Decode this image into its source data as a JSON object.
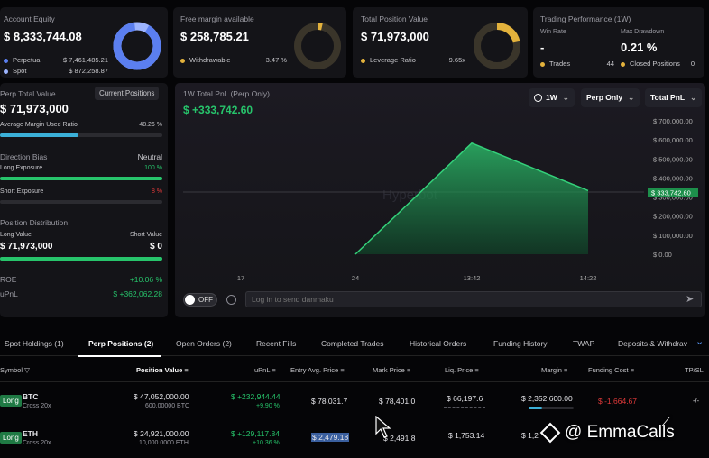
{
  "account": {
    "label": "Account Equity",
    "value": "$ 8,333,744.08",
    "perp_label": "Perpetual",
    "perp_value": "$ 7,461,485.21",
    "spot_label": "Spot",
    "spot_value": "$ 872,258.87",
    "color_perp": "#5b7ff0",
    "color_spot": "#9db4ff"
  },
  "margin": {
    "label": "Free margin available",
    "value": "$ 258,785.21",
    "withdrawable_label": "Withdrawable",
    "withdrawable_value": "3.47 %",
    "color": "#e3b23c"
  },
  "position": {
    "label": "Total Position Value",
    "value": "$ 71,973,000",
    "leverage_label": "Leverage Ratio",
    "leverage_value": "9.65x",
    "color": "#e3b23c"
  },
  "performance": {
    "title": "Trading Performance (1W)",
    "win_rate_label": "Win Rate",
    "win_rate_value": "-",
    "drawdown_label": "Max Drawdown",
    "drawdown_value": "0.21 %",
    "trades_label": "Trades",
    "trades_value": "44",
    "closed_label": "Closed Positions",
    "closed_value": "0"
  },
  "perp_panel": {
    "label": "Perp Total Value",
    "current_positions_btn": "Current Positions",
    "value": "$ 71,973,000",
    "margin_ratio_label": "Average Margin Used Ratio",
    "margin_ratio_value": "48.26 %",
    "margin_ratio": 0.4826,
    "direction_label": "Direction Bias",
    "direction_value": "Neutral",
    "long_exposure_label": "Long Exposure",
    "long_exposure_value": "100 %",
    "long_exposure": 1.0,
    "short_exposure_label": "Short Exposure",
    "short_exposure_value": "8 %",
    "short_exposure": 0.0,
    "distribution_label": "Position Distribution",
    "long_value_label": "Long Value",
    "long_value": "$ 71,973,000",
    "short_value_label": "Short Value",
    "short_value": "$ 0",
    "roe_label": "ROE",
    "roe_value": "+10.06 %",
    "upnl_label": "uPnL",
    "upnl_value": "$ +362,062.28"
  },
  "pnl_chart": {
    "title": "1W Total PnL (Perp Only)",
    "value": "$ +333,742.60",
    "period": "1W",
    "filter": "Perp Only",
    "metric": "Total PnL",
    "watermark": "Hyperbot",
    "current_label": "$ 333,742.60"
  },
  "chart_data": {
    "type": "area",
    "x": [
      "17",
      "24",
      "13:42",
      "14:22"
    ],
    "points": [
      {
        "x": "24",
        "y": 0
      },
      {
        "x": "13:42",
        "y": 583000
      },
      {
        "x": "14:22",
        "y": 333742.6
      }
    ],
    "yticks": [
      "$ 700,000.00",
      "$ 600,000.00",
      "$ 500,000.00",
      "$ 400,000.00",
      "$ 300,000.00",
      "$ 200,000.00",
      "$ 100,000.00",
      "$ 0.00"
    ],
    "ylim": [
      0,
      700000
    ]
  },
  "danmaku": {
    "toggle": "OFF",
    "placeholder": "Log in to send danmaku"
  },
  "tabs": [
    "Spot Holdings (1)",
    "Perp Positions (2)",
    "Open Orders (2)",
    "Recent Fills",
    "Completed Trades",
    "Historical Orders",
    "Funding History",
    "TWAP",
    "Deposits & Withdrav"
  ],
  "headers": {
    "symbol": "Symbol",
    "position_value": "Position Value",
    "upnl": "uPnL",
    "entry": "Entry Avg. Price",
    "mark": "Mark Price",
    "liq": "Liq. Price",
    "margin": "Margin",
    "funding": "Funding Cost",
    "tpsl": "TP/SL"
  },
  "rows": [
    {
      "side": "Long",
      "symbol": "BTC",
      "mode": "Cross 20x",
      "pos_value": "$ 47,052,000.00",
      "size": "600.00000 BTC",
      "upnl": "$ +232,944.44",
      "upnl_pct": "+9.90 %",
      "entry": "$ 78,031.7",
      "mark": "$ 78,401.0",
      "liq": "$ 66,197.6",
      "margin": "$ 2,352,600.00",
      "funding": "$ -1,664.67",
      "tpsl": "-/-"
    },
    {
      "side": "Long",
      "symbol": "ETH",
      "mode": "Cross 20x",
      "pos_value": "$ 24,921,000.00",
      "size": "10,000.0000 ETH",
      "upnl": "$ +129,117.84",
      "upnl_pct": "+10.36 %",
      "entry": "$ 2,479.18",
      "mark": "$ 2,491.8",
      "liq": "$ 1,753.14",
      "margin": "$ 1,2",
      "funding": "",
      "tpsl": ""
    }
  ],
  "watermark_text": "@ EmmaCalls"
}
